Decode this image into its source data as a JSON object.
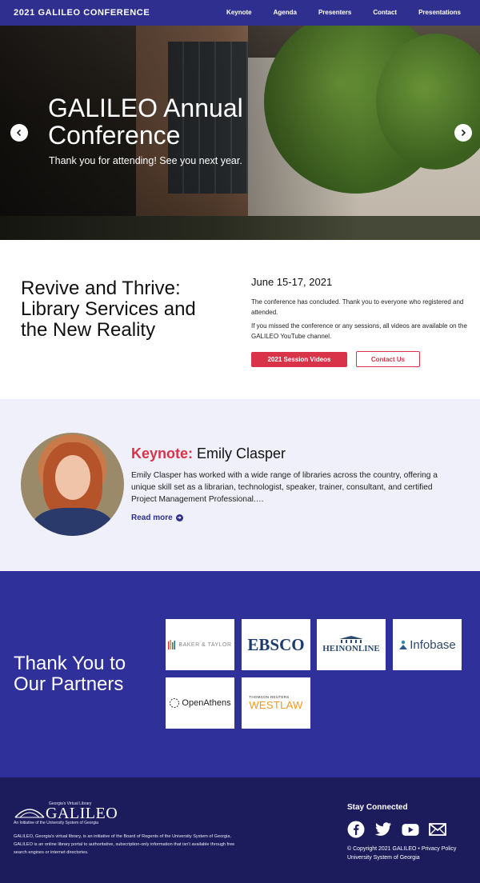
{
  "nav": {
    "brand": "2021 GALILEO CONFERENCE",
    "links": [
      "Keynote",
      "Agenda",
      "Presenters",
      "Contact",
      "Presentations"
    ]
  },
  "hero": {
    "title": "GALILEO Annual Conference",
    "subtitle": "Thank you for attending! See you next year.",
    "prev_icon": "chevron-left-icon",
    "next_icon": "chevron-right-icon"
  },
  "intro": {
    "heading": "Revive and Thrive: Library Services and the New Reality",
    "date": "June 15-17, 2021",
    "paragraph1": "The conference has concluded. Thank you to everyone who registered and attended.",
    "paragraph2": "If you missed the conference or any sessions, all videos are available on the GALILEO YouTube channel.",
    "button_primary": "2021 Session Videos",
    "button_secondary": "Contact Us"
  },
  "keynote": {
    "label": "Keynote:",
    "name": "Emily Clasper",
    "description": "Emily Clasper has worked with a wide range of libraries across the country, offering a unique skill set as a librarian, technologist, speaker, trainer, consultant, and certified Project Management Professional.…",
    "read_more": "Read more"
  },
  "partners": {
    "heading": "Thank You to Our Partners",
    "logos": [
      {
        "text": "BAKER & TAYLOR"
      },
      {
        "text": "EBSCO"
      },
      {
        "text": "HEINONLINE"
      },
      {
        "text": "Infobase"
      },
      {
        "text": "OpenAthens"
      },
      {
        "pre": "THOMSON REUTERS",
        "text": "WESTLAW"
      }
    ]
  },
  "footer": {
    "logo_tagline": "Georgia's Virtual Library",
    "logo_word": "GALILEO",
    "logo_sub": "An Initiative of the University System of Georgia",
    "blurb": "GALILEO, Georgia's virtual library, is an initiative of the Board of Regents of the University System of Georgia. GALILEO is an online library portal to authoritative, subscription-only information that isn't available through free search engines or internet directories.",
    "stay": "Stay Connected",
    "icons": [
      "facebook-icon",
      "twitter-icon",
      "youtube-icon",
      "email-icon"
    ],
    "copyright": "© Copyright 2021 GALILEO • Privacy Policy",
    "usg": "University System of Georgia"
  },
  "colors": {
    "primary": "#2f2f8f",
    "accent": "#d9334a",
    "footer": "#1c1c5c",
    "keynote_bg": "#eff0f9"
  }
}
